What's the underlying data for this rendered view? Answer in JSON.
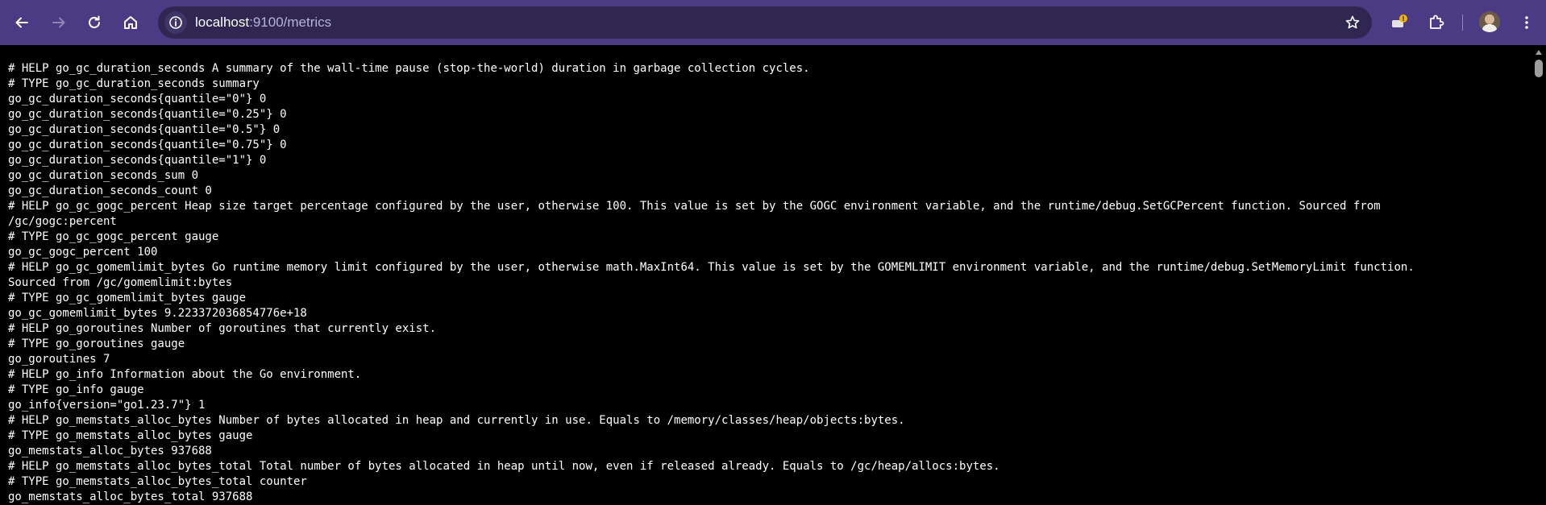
{
  "toolbar": {
    "back_icon": "arrow-left-icon",
    "forward_icon": "arrow-right-icon",
    "reload_icon": "reload-icon",
    "home_icon": "home-icon",
    "omnibox": {
      "site_info_icon": "info-icon",
      "host": "localhost",
      "path": ":9100/metrics",
      "bookmark_icon": "star-icon"
    },
    "extension_badge_icon": "notification-extension-icon",
    "extensions_icon": "puzzle-icon",
    "profile_icon": "avatar",
    "menu_icon": "kebab-menu-icon",
    "colors": {
      "toolbar_bg": "#4a3b84",
      "omnibox_bg": "#2f2752",
      "badge": "#f5b400"
    }
  },
  "page": {
    "background": "#000000",
    "text_color": "#ffffff",
    "lines": [
      "# HELP go_gc_duration_seconds A summary of the wall-time pause (stop-the-world) duration in garbage collection cycles.",
      "# TYPE go_gc_duration_seconds summary",
      "go_gc_duration_seconds{quantile=\"0\"} 0",
      "go_gc_duration_seconds{quantile=\"0.25\"} 0",
      "go_gc_duration_seconds{quantile=\"0.5\"} 0",
      "go_gc_duration_seconds{quantile=\"0.75\"} 0",
      "go_gc_duration_seconds{quantile=\"1\"} 0",
      "go_gc_duration_seconds_sum 0",
      "go_gc_duration_seconds_count 0",
      "# HELP go_gc_gogc_percent Heap size target percentage configured by the user, otherwise 100. This value is set by the GOGC environment variable, and the runtime/debug.SetGCPercent function. Sourced from",
      "/gc/gogc:percent",
      "# TYPE go_gc_gogc_percent gauge",
      "go_gc_gogc_percent 100",
      "# HELP go_gc_gomemlimit_bytes Go runtime memory limit configured by the user, otherwise math.MaxInt64. This value is set by the GOMEMLIMIT environment variable, and the runtime/debug.SetMemoryLimit function.",
      "Sourced from /gc/gomemlimit:bytes",
      "# TYPE go_gc_gomemlimit_bytes gauge",
      "go_gc_gomemlimit_bytes 9.223372036854776e+18",
      "# HELP go_goroutines Number of goroutines that currently exist.",
      "# TYPE go_goroutines gauge",
      "go_goroutines 7",
      "# HELP go_info Information about the Go environment.",
      "# TYPE go_info gauge",
      "go_info{version=\"go1.23.7\"} 1",
      "# HELP go_memstats_alloc_bytes Number of bytes allocated in heap and currently in use. Equals to /memory/classes/heap/objects:bytes.",
      "# TYPE go_memstats_alloc_bytes gauge",
      "go_memstats_alloc_bytes 937688",
      "# HELP go_memstats_alloc_bytes_total Total number of bytes allocated in heap until now, even if released already. Equals to /gc/heap/allocs:bytes.",
      "# TYPE go_memstats_alloc_bytes_total counter",
      "go_memstats_alloc_bytes_total 937688"
    ]
  }
}
